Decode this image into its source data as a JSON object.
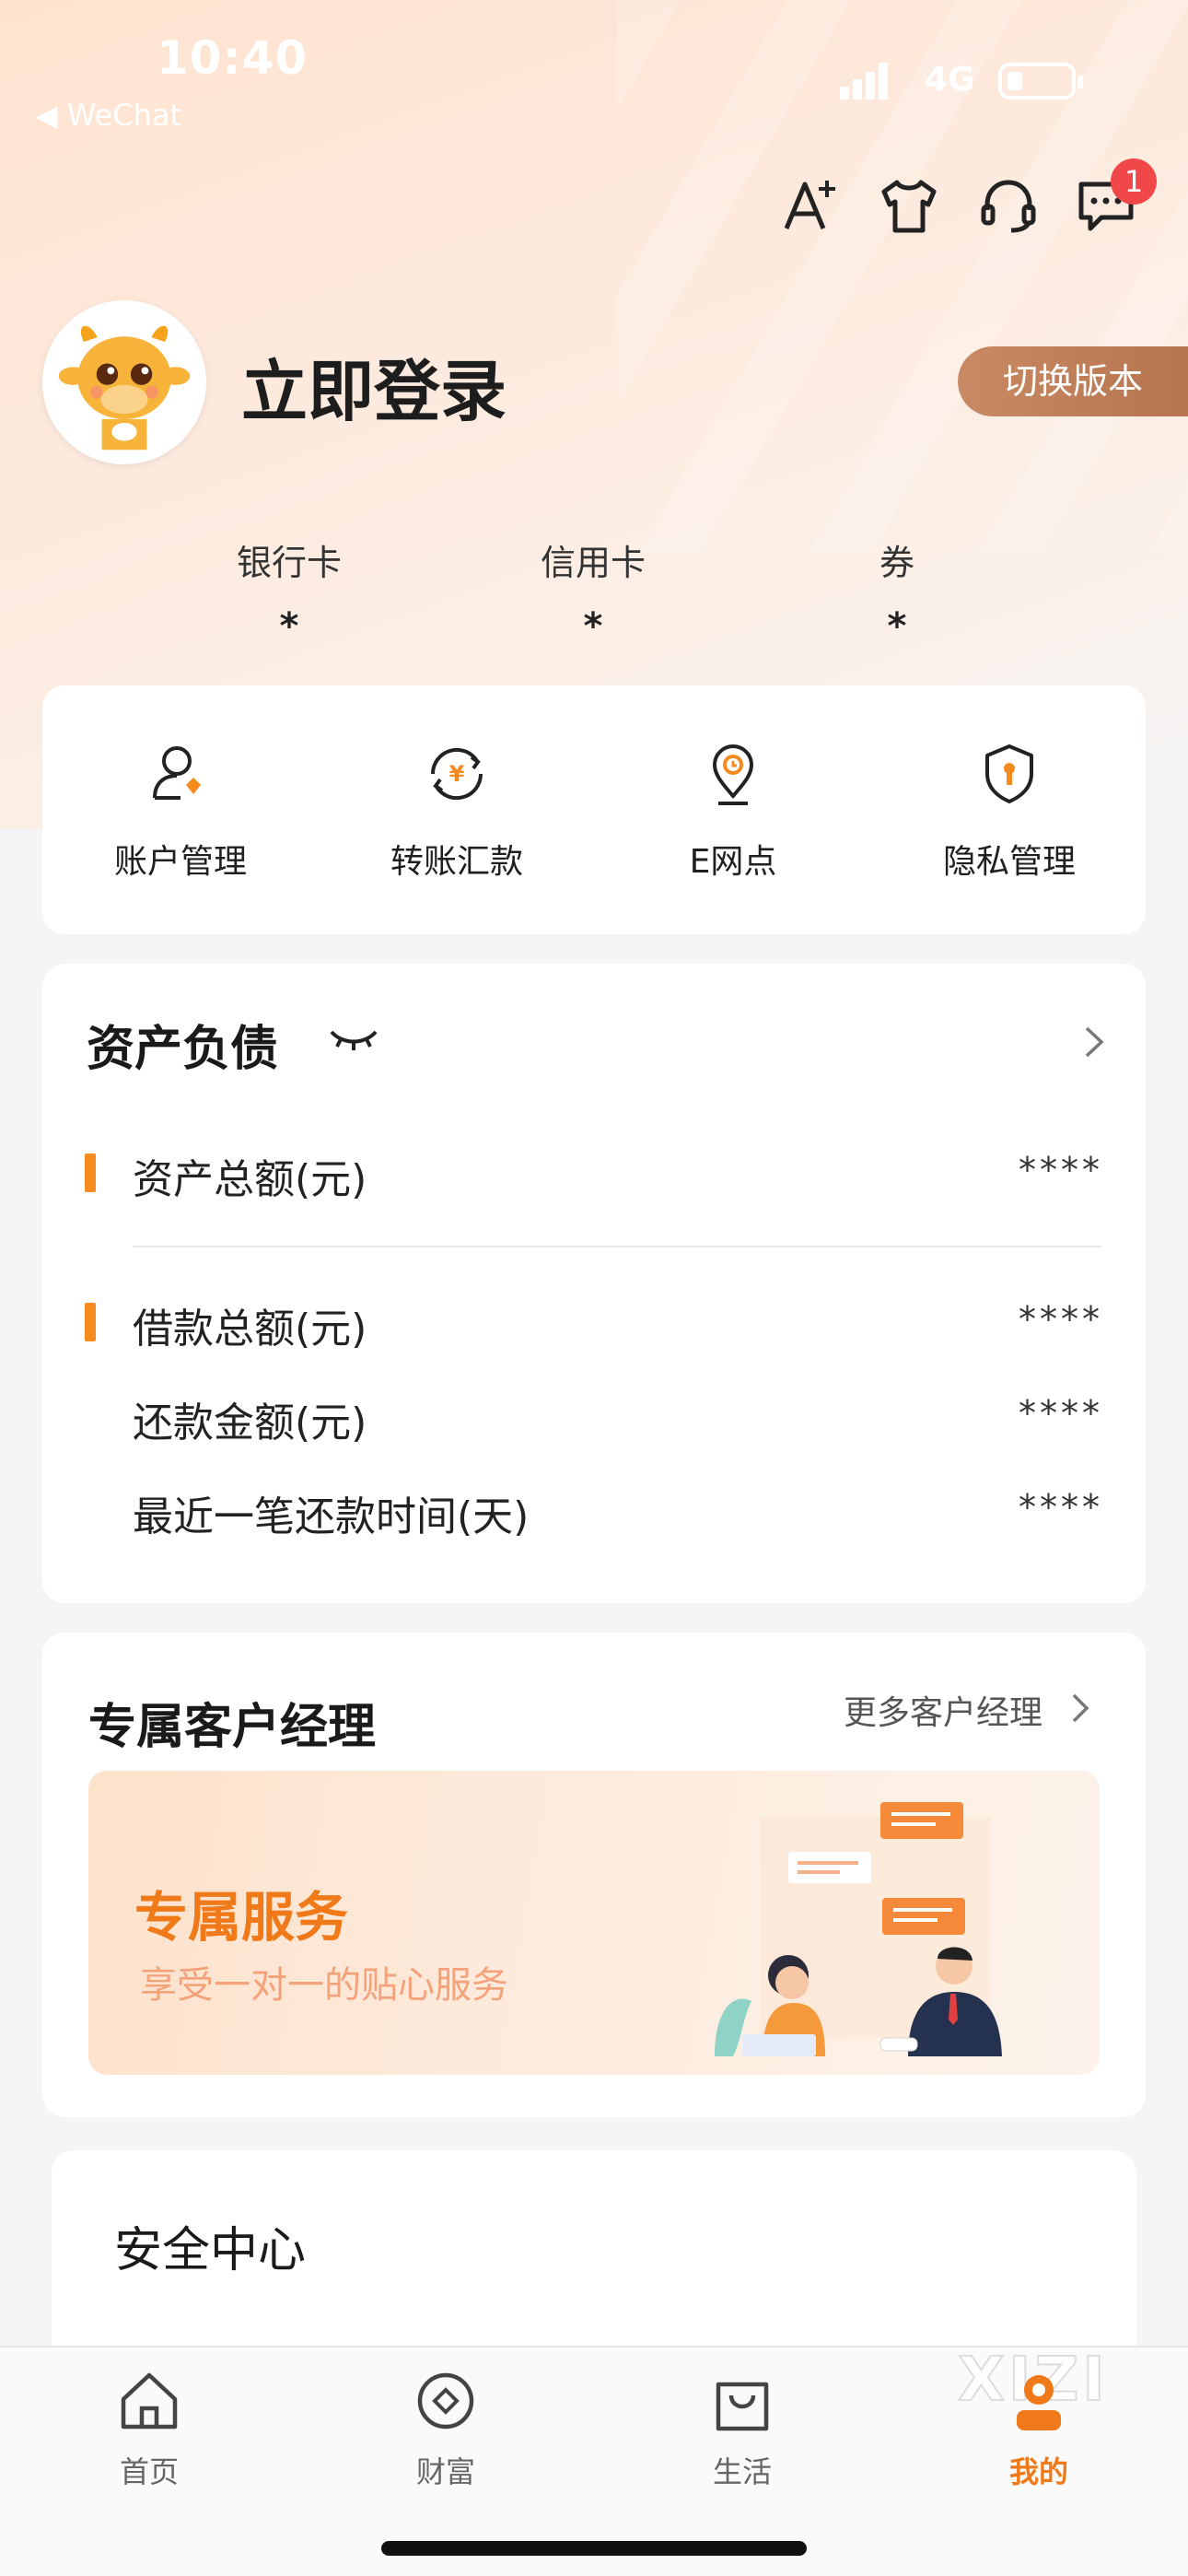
{
  "status_bar": {
    "time": "10:40",
    "back_app": "◀ WeChat",
    "network": "4G"
  },
  "top_actions": {
    "font_icon": "font-size-plus-icon",
    "theme_icon": "tshirt-icon",
    "service_icon": "headset-icon",
    "message_icon": "message-icon",
    "message_badge": "1"
  },
  "profile": {
    "login_label": "立即登录",
    "switch_version": "切换版本"
  },
  "stats": [
    {
      "label": "银行卡",
      "value": "*"
    },
    {
      "label": "信用卡",
      "value": "*"
    },
    {
      "label": "券",
      "value": "*"
    }
  ],
  "quick_actions": [
    {
      "label": "账户管理",
      "icon": "account-icon"
    },
    {
      "label": "转账汇款",
      "icon": "transfer-icon"
    },
    {
      "label": "E网点",
      "icon": "location-icon"
    },
    {
      "label": "隐私管理",
      "icon": "shield-icon"
    }
  ],
  "assets": {
    "title": "资产负债",
    "rows": [
      {
        "label": "资产总额(元)",
        "value": "****"
      },
      {
        "label": "借款总额(元)",
        "value": "****"
      },
      {
        "label": "还款金额(元)",
        "value": "****"
      },
      {
        "label": "最近一笔还款时间(天)",
        "value": "****"
      }
    ]
  },
  "manager": {
    "title": "专属客户经理",
    "more": "更多客户经理",
    "banner_title": "专属服务",
    "banner_sub": "享受一对一的贴心服务"
  },
  "security": {
    "title": "安全中心"
  },
  "bottom_nav": [
    {
      "label": "首页",
      "icon": "home-icon"
    },
    {
      "label": "财富",
      "icon": "wealth-icon"
    },
    {
      "label": "生活",
      "icon": "shopping-bag-icon"
    },
    {
      "label": "我的",
      "icon": "profile-icon",
      "active": true
    }
  ],
  "watermark": "XIZI",
  "colors": {
    "accent": "#f07a1a",
    "switch_bg": "#b6744f",
    "badge": "#f04848"
  }
}
